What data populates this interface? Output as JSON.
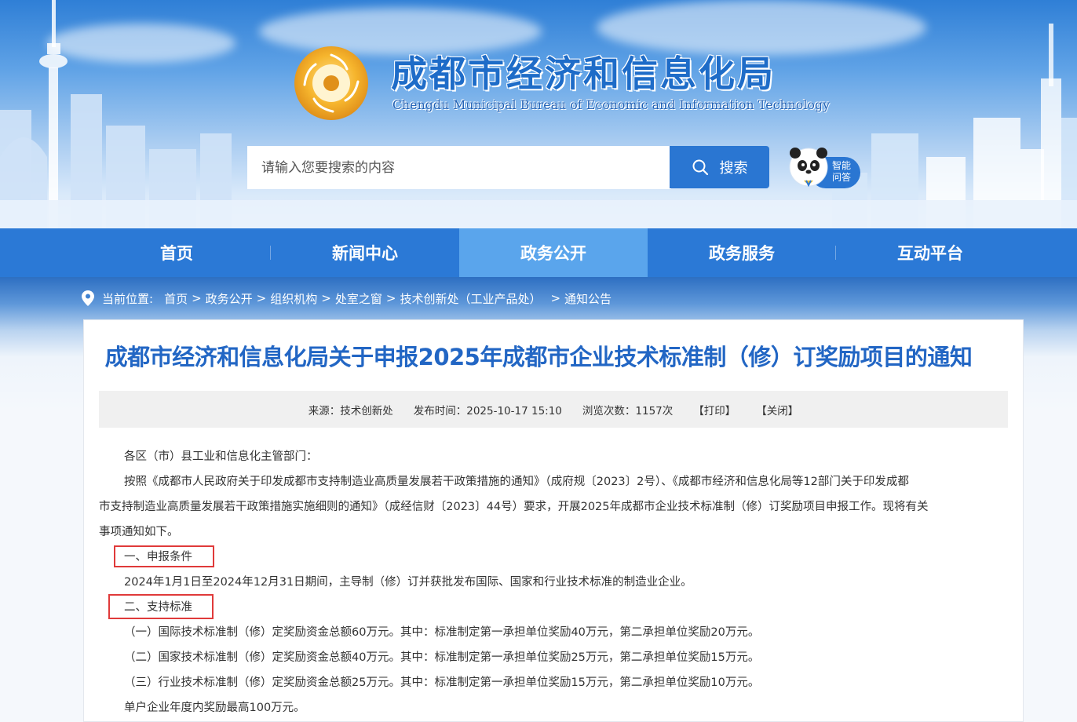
{
  "header": {
    "title": "成都市经济和信息化局",
    "subtitle": "Chengdu Municipal Bureau of Economic and Information Technology"
  },
  "search": {
    "placeholder": "请输入您要搜索的内容",
    "button_label": "搜索"
  },
  "ai_assistant": {
    "label_line1": "智能",
    "label_line2": "问答"
  },
  "nav": {
    "items": [
      {
        "label": "首页"
      },
      {
        "label": "新闻中心"
      },
      {
        "label": "政务公开",
        "active": true
      },
      {
        "label": "政务服务"
      },
      {
        "label": "互动平台"
      }
    ]
  },
  "breadcrumb": {
    "prefix": "当前位置:",
    "items": [
      "首页",
      "政务公开",
      "组织机构",
      "处室之窗",
      "技术创新处（工业产品处）",
      "通知公告"
    ],
    "separator": ">"
  },
  "article": {
    "title": "成都市经济和信息化局关于申报2025年成都市企业技术标准制（修）订奖励项目的通知",
    "meta": {
      "source": "来源：技术创新处",
      "published": "发布时间：2025-10-17 15:10",
      "views": "浏览次数：1157次",
      "print_label": "【打印】",
      "close_label": "【关闭】"
    },
    "paragraphs": {
      "salutation": "各区（市）县工业和信息化主管部门：",
      "intro_line1": "按照《成都市人民政府关于印发成都市支持制造业高质量发展若干政策措施的通知》（成府规〔2023〕2号）、《成都市经济和信息化局等12部门关于印发成都",
      "intro_line2": "市支持制造业高质量发展若干政策措施实施细则的通知》（成经信财〔2023〕44号）要求，开展2025年成都市企业技术标准制（修）订奖励项目申报工作。现将有关",
      "intro_line3": "事项通知如下。",
      "section1_heading": "一、申报条件",
      "section1_text": "2024年1月1日至2024年12月31日期间，主导制（修）订并获批发布国际、国家和行业技术标准的制造业企业。",
      "section2_heading": "二、支持标准",
      "item1": "（一）国际技术标准制（修）定奖励资金总额60万元。其中：标准制定第一承担单位奖励40万元，第二承担单位奖励20万元。",
      "item2": "（二）国家技术标准制（修）定奖励资金总额40万元。其中：标准制定第一承担单位奖励25万元，第二承担单位奖励15万元。",
      "item3": "（三）行业技术标准制（修）定奖励资金总额25万元。其中：标准制定第一承担单位奖励15万元，第二承担单位奖励10万元。",
      "cap": "单户企业年度内奖励最高100万元。"
    }
  },
  "colors": {
    "brand_blue": "#2b79d6",
    "nav_active": "#5aa5ec",
    "title_blue": "#2266c4",
    "highlight_red": "#e03a3a"
  }
}
